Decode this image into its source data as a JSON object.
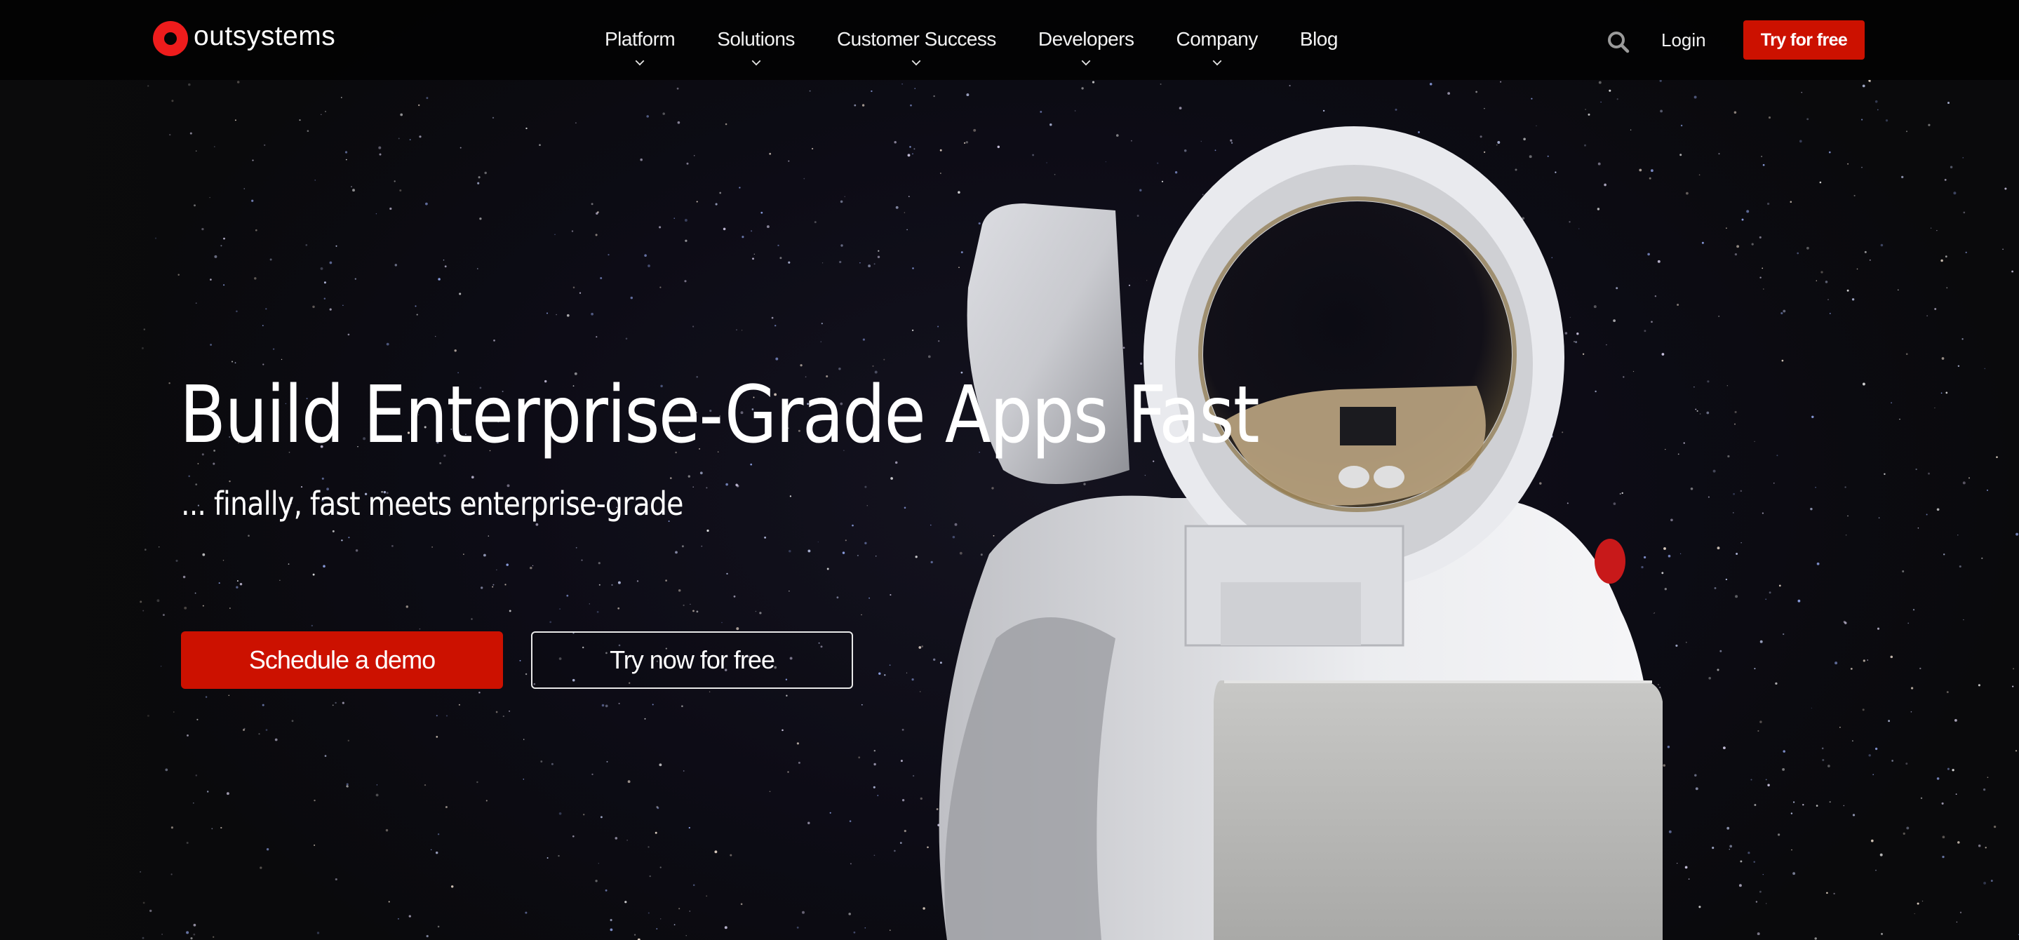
{
  "brand": {
    "name": "outsystems",
    "accent_color": "#cc1100",
    "logo_color": "#ee1c1c"
  },
  "nav": {
    "items": [
      {
        "label": "Platform",
        "has_dropdown": true
      },
      {
        "label": "Solutions",
        "has_dropdown": true
      },
      {
        "label": "Customer Success",
        "has_dropdown": true
      },
      {
        "label": "Developers",
        "has_dropdown": true
      },
      {
        "label": "Company",
        "has_dropdown": true
      },
      {
        "label": "Blog",
        "has_dropdown": false
      }
    ],
    "search_icon": "search-icon",
    "login_label": "Login",
    "try_free_label": "Try for free"
  },
  "hero": {
    "headline": "Build Enterprise-Grade Apps Fast",
    "subheadline": "... finally, fast meets enterprise-grade",
    "primary_cta": "Schedule a demo",
    "secondary_cta": "Try now for free",
    "image": "astronaut-with-laptop"
  }
}
